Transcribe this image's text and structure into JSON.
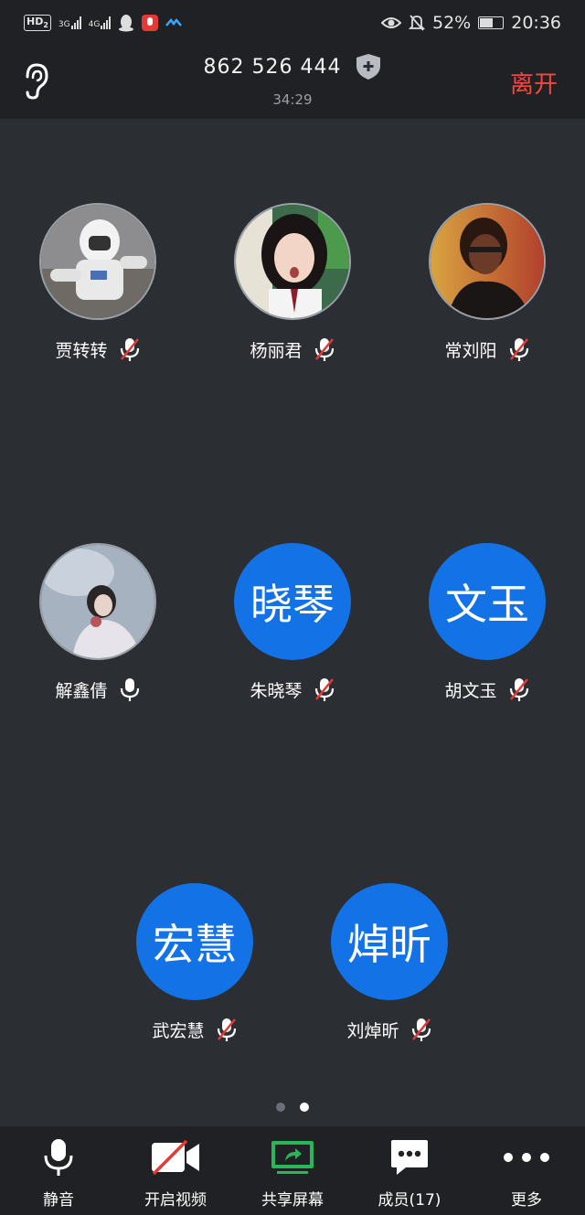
{
  "status_bar": {
    "hd": "HD",
    "hd_sub": "2",
    "net1": "3G",
    "net2": "4G",
    "battery": "52%",
    "time": "20:36"
  },
  "header": {
    "meeting_id": "862 526 444",
    "timer": "34:29",
    "leave": "离开"
  },
  "participants": [
    {
      "name": "贾转转",
      "avatar": "photo-astronaut",
      "mic": "muted"
    },
    {
      "name": "杨丽君",
      "avatar": "photo-girl",
      "mic": "muted"
    },
    {
      "name": "常刘阳",
      "avatar": "photo-man",
      "mic": "muted"
    },
    {
      "name": "解鑫倩",
      "avatar": "photo-woman",
      "mic": "on"
    },
    {
      "name": "朱晓琴",
      "avatar_text": "晓琴",
      "mic": "muted"
    },
    {
      "name": "胡文玉",
      "avatar_text": "文玉",
      "mic": "muted"
    },
    {
      "name": "武宏慧",
      "avatar_text": "宏慧",
      "mic": "muted"
    },
    {
      "name": "刘焯昕",
      "avatar_text": "焯昕",
      "mic": "muted"
    }
  ],
  "pager": {
    "pages": 2,
    "current": 2
  },
  "toolbar": {
    "mute": "静音",
    "video": "开启视频",
    "share": "共享屏幕",
    "members": "成员(17)",
    "more": "更多"
  },
  "colors": {
    "background": "#2b2e33",
    "bar": "#1f2124",
    "avatar_blue": "#1272e6",
    "leave_red": "#ef4a3f",
    "share_green": "#2bb55a"
  }
}
